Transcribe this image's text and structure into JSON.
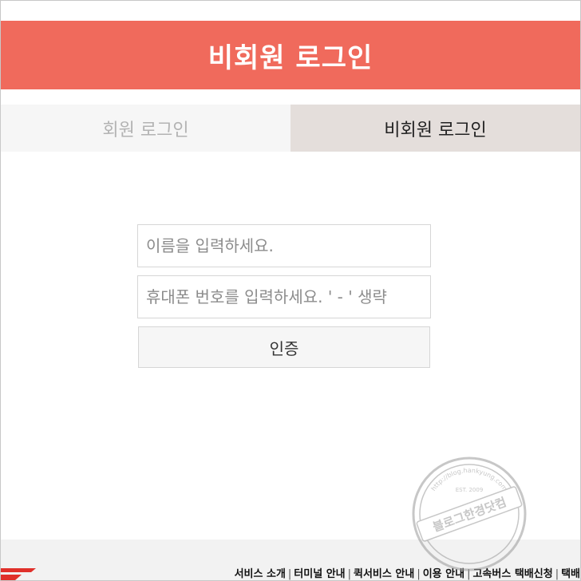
{
  "header": {
    "title": "비회원 로그인"
  },
  "tabs": [
    {
      "label": "회원 로그인",
      "active": false
    },
    {
      "label": "비회원 로그인",
      "active": true
    }
  ],
  "form": {
    "name_placeholder": "이름을 입력하세요.",
    "phone_placeholder": "휴대폰 번호를 입력하세요. ' - ' 생략",
    "submit_label": "인증"
  },
  "footer": {
    "links": [
      "서비스 소개",
      "터미널 안내",
      "퀵서비스 안내",
      "이용 안내",
      "고속버스 택배신청",
      "택배"
    ]
  },
  "watermark": {
    "main_text": "블로그한경닷컴",
    "url_text": "http://blog.hankyung.com",
    "est_text": "EST. 2009"
  },
  "colors": {
    "header_bg": "#f06a5c",
    "active_tab_bg": "#e4dedb",
    "inactive_tab_bg": "#f6f6f6"
  }
}
